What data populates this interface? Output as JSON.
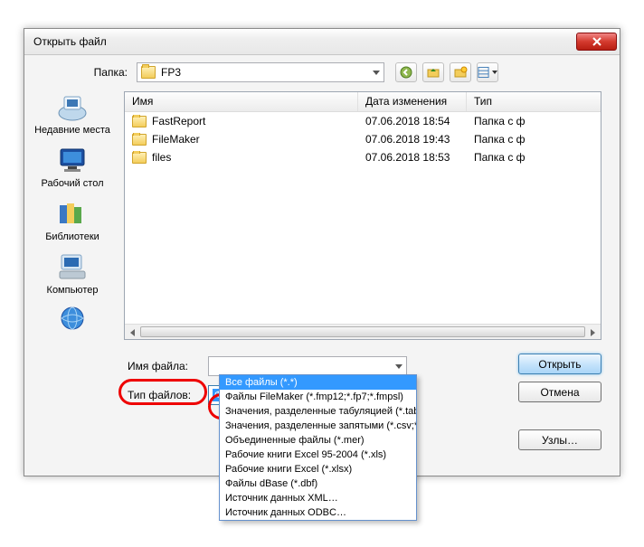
{
  "title": "Открыть файл",
  "folder": {
    "label": "Папка:",
    "value": "FP3"
  },
  "toolbar_icons": [
    "back-icon",
    "up-icon",
    "new-folder-icon",
    "view-icon"
  ],
  "sidebar": [
    {
      "name": "recent",
      "label": "Недавние места"
    },
    {
      "name": "desktop",
      "label": "Рабочий стол"
    },
    {
      "name": "libraries",
      "label": "Библиотеки"
    },
    {
      "name": "computer",
      "label": "Компьютер"
    },
    {
      "name": "network",
      "label": ""
    }
  ],
  "columns": {
    "name": "Имя",
    "date": "Дата изменения",
    "type": "Тип"
  },
  "files": [
    {
      "name": "FastReport",
      "date": "07.06.2018 18:54",
      "type": "Папка с ф"
    },
    {
      "name": "FileMaker",
      "date": "07.06.2018 19:43",
      "type": "Папка с ф"
    },
    {
      "name": "files",
      "date": "07.06.2018 18:53",
      "type": "Папка с ф"
    }
  ],
  "filename_label": "Имя файла:",
  "filetype_label": "Тип файлов:",
  "filetype_selected": "Файлы FileMaker (*.fmp12;*.fp7;*.fmpsl)",
  "buttons": {
    "open": "Открыть",
    "cancel": "Отмена",
    "hosts": "Узлы…"
  },
  "filetype_options": [
    "Все файлы (*.*)",
    "Файлы FileMaker (*.fmp12;*.fp7;*.fmpsl)",
    "Значения, разделенные табуляцией (*.tab;*.txt)",
    "Значения, разделенные запятыми (*.csv;*.txt)",
    "Объединенные файлы (*.mer)",
    "Рабочие книги Excel 95-2004 (*.xls)",
    "Рабочие книги Excel (*.xlsx)",
    "Файлы dBase (*.dbf)",
    "Источник данных XML…",
    "Источник данных ODBC…"
  ]
}
